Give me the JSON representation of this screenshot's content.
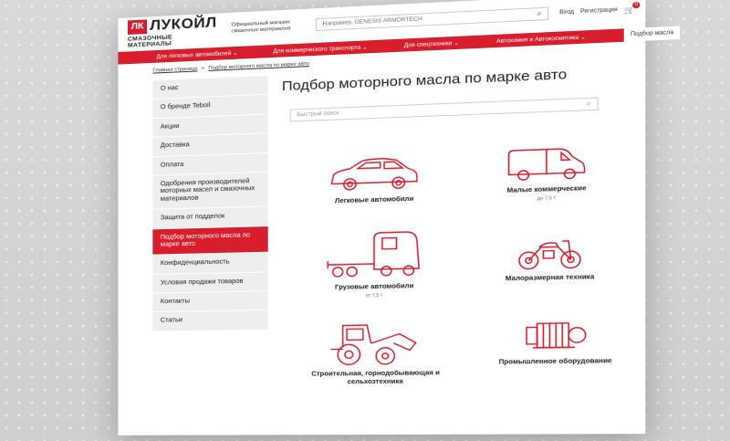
{
  "header": {
    "logo_mark": "ЛК",
    "logo_text": "ЛУКОЙЛ",
    "logo_sub": "СМАЗОЧНЫЕ МАТЕРИАЛЫ",
    "tagline": "Официальный магазин смазочных материалов",
    "search_placeholder": "Например, GENESIS ARMORTECH",
    "login": "Вход",
    "register": "Регистрация",
    "cart_count": "0"
  },
  "nav": {
    "items": [
      "Для легковых автомобилей ⌄",
      "Для коммерческого транспорта ⌄",
      "Для спецтехники ⌄",
      "Автохимия и Автокосметика ⌄"
    ],
    "active": "Подбор масла"
  },
  "breadcrumb": {
    "home": "Главная страница",
    "sep": ">",
    "current": "Подбор моторного масла по марке авто"
  },
  "sidebar": {
    "items": [
      "О нас",
      "О бренде Teboil",
      "Акции",
      "Доставка",
      "Оплата",
      "Одобрения производителей моторных масел и смазочных материалов",
      "Защита от подделок",
      "Подбор моторного масла по марке авто",
      "Конфиденциальность",
      "Условия продажи товаров",
      "Контакты",
      "Статьи"
    ],
    "active_index": 7
  },
  "main": {
    "title": "Подбор моторного масла по марке авто",
    "quick_search_placeholder": "Быстрый поиск"
  },
  "categories": [
    {
      "title": "Легковые автомобили",
      "sub": "",
      "icon": "car-icon"
    },
    {
      "title": "Малые коммерческие",
      "sub": "до 7,5 т",
      "icon": "van-icon"
    },
    {
      "title": "Грузовые автомобили",
      "sub": "от 7,5 т",
      "icon": "truck-icon"
    },
    {
      "title": "Малоразмерная техника",
      "sub": "",
      "icon": "motorcycle-icon"
    },
    {
      "title": "Строительная, горнодобывающая и сельхозтехника",
      "sub": "",
      "icon": "loader-icon"
    },
    {
      "title": "Промышленное оборудование",
      "sub": "",
      "icon": "motor-icon"
    }
  ],
  "colors": {
    "brand": "#d81e2c"
  }
}
